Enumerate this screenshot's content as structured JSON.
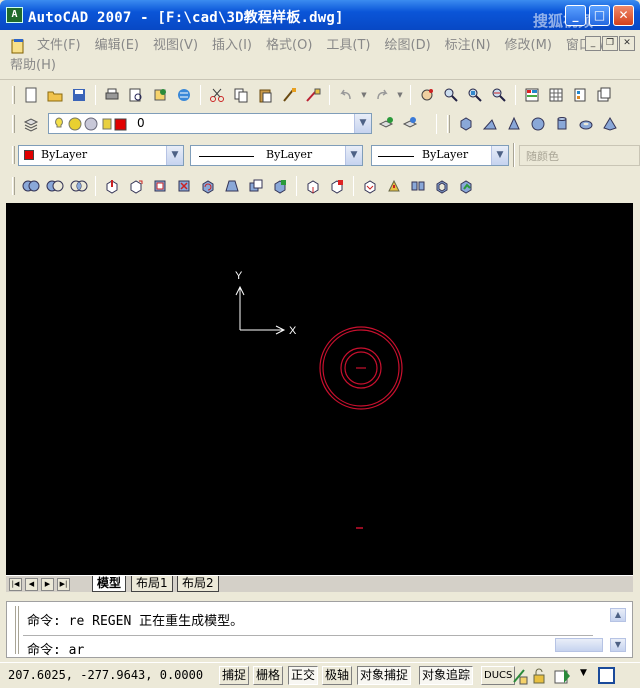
{
  "window": {
    "title": "AutoCAD 2007 - [F:\\cad\\3D教程样板.dwg]",
    "app_icon_text": "A",
    "watermark": "搜狐视频"
  },
  "menu": {
    "items": [
      "文件(F)",
      "编辑(E)",
      "视图(V)",
      "插入(I)",
      "格式(O)",
      "工具(T)",
      "绘图(D)",
      "标注(N)",
      "修改(M)",
      "窗口(W)"
    ],
    "help": "帮助(H)"
  },
  "layer": {
    "current": "0",
    "color": "#e00000"
  },
  "properties": {
    "color_value": "ByLayer",
    "linetype_value": "ByLayer",
    "lineweight_value": "ByLayer",
    "plotstyle_value": "随颜色"
  },
  "canvas": {
    "ucs_x_label": "X",
    "ucs_y_label": "Y",
    "object_color": "#c8102e"
  },
  "layout_tabs": [
    "模型",
    "布局1",
    "布局2"
  ],
  "command": {
    "history": "命令: re REGEN 正在重生成模型。",
    "current": "命令: ar"
  },
  "status": {
    "coordinates": "207.6025, -277.9643, 0.0000",
    "toggles": [
      {
        "label": "捕捉",
        "on": false
      },
      {
        "label": "栅格",
        "on": false
      },
      {
        "label": "正交",
        "on": true
      },
      {
        "label": "极轴",
        "on": false
      },
      {
        "label": "对象捕捉",
        "on": true
      },
      {
        "label": "对象追踪",
        "on": true
      },
      {
        "label": "DUCS",
        "on": false
      }
    ]
  }
}
